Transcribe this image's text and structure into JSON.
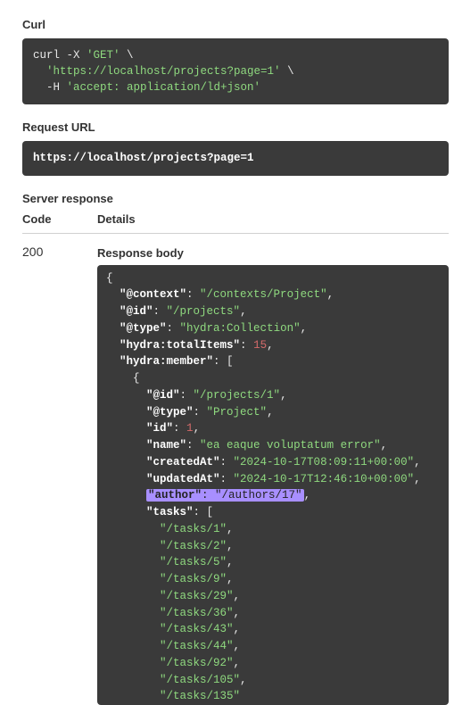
{
  "sections": {
    "curl_title": "Curl",
    "request_url_title": "Request URL",
    "server_response_title": "Server response",
    "code_header": "Code",
    "details_header": "Details",
    "response_body_title": "Response body"
  },
  "curl": {
    "line1_cmd": "curl -X ",
    "line1_method": "'GET'",
    "line1_bs": " \\",
    "line2_indent": "  ",
    "line2_url": "'https://localhost/projects?page=1'",
    "line2_bs": " \\",
    "line3_indent": "  -H ",
    "line3_header": "'accept: application/ld+json'"
  },
  "request_url": "https://localhost/projects?page=1",
  "response": {
    "status": "200"
  },
  "json": {
    "context_key": "\"@context\"",
    "context_val": "\"/contexts/Project\"",
    "id_key": "\"@id\"",
    "id_val": "\"/projects\"",
    "type_key": "\"@type\"",
    "type_val": "\"hydra:Collection\"",
    "total_key": "\"hydra:totalItems\"",
    "total_val": "15",
    "member_key": "\"hydra:member\"",
    "m_id_key": "\"@id\"",
    "m_id_val": "\"/projects/1\"",
    "m_type_key": "\"@type\"",
    "m_type_val": "\"Project\"",
    "m_pid_key": "\"id\"",
    "m_pid_val": "1",
    "m_name_key": "\"name\"",
    "m_name_val": "\"ea eaque voluptatum error\"",
    "m_created_key": "\"createdAt\"",
    "m_created_val": "\"2024-10-17T08:09:11+00:00\"",
    "m_updated_key": "\"updatedAt\"",
    "m_updated_val": "\"2024-10-17T12:46:10+00:00\"",
    "m_author_key": "\"author\"",
    "m_author_val": "\"/authors/17\"",
    "m_tasks_key": "\"tasks\"",
    "tasks": [
      "\"/tasks/1\"",
      "\"/tasks/2\"",
      "\"/tasks/5\"",
      "\"/tasks/9\"",
      "\"/tasks/29\"",
      "\"/tasks/36\"",
      "\"/tasks/43\"",
      "\"/tasks/44\"",
      "\"/tasks/92\"",
      "\"/tasks/105\"",
      "\"/tasks/135\""
    ]
  }
}
